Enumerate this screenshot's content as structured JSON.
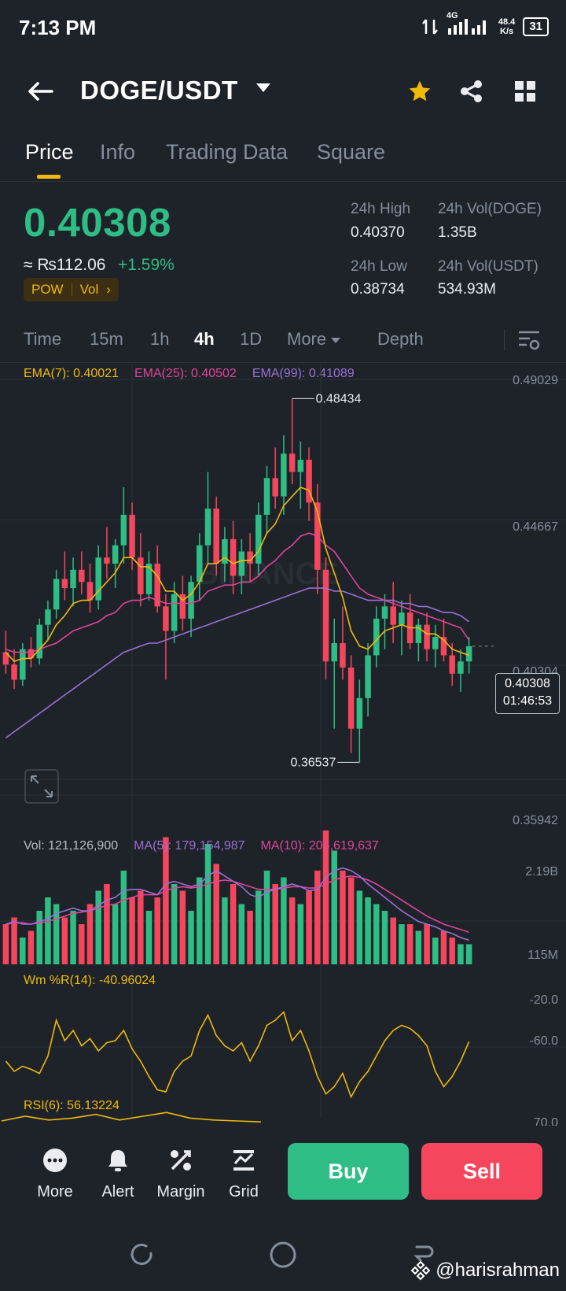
{
  "status_bar": {
    "time": "7:13 PM",
    "network": "4G",
    "speed_value": "48.4",
    "speed_unit": "K/s",
    "battery": "31"
  },
  "header": {
    "pair": "DOGE/USDT",
    "back_icon": "arrow-left-icon",
    "favorite_icon": "star-icon",
    "share_icon": "share-icon",
    "apps_icon": "grid-icon",
    "favorite_color": "#f0b90b"
  },
  "tabs": [
    "Price",
    "Info",
    "Trading Data",
    "Square"
  ],
  "active_tab": "Price",
  "price": {
    "last": "0.40308",
    "inr": "≈ ₨112.06",
    "change_pct": "+1.59%",
    "tag1": "POW",
    "tag2": "Vol",
    "tag_arrow": "›"
  },
  "stats": {
    "high_label": "24h High",
    "high_value": "0.40370",
    "low_label": "24h Low",
    "low_value": "0.38734",
    "vol_base_label": "24h Vol(DOGE)",
    "vol_base_value": "1.35B",
    "vol_quote_label": "24h Vol(USDT)",
    "vol_quote_value": "534.93M"
  },
  "intervals": [
    "Time",
    "15m",
    "1h",
    "4h",
    "1D",
    "More",
    "Depth"
  ],
  "active_interval": "4h",
  "indicators": {
    "ema7": "EMA(7): 0.40021",
    "ema25": "EMA(25): 0.40502",
    "ema99": "EMA(99): 0.41089",
    "vol": "Vol: 121,126,900",
    "ma5": "MA(5): 179,154,987",
    "ma10": "MA(10): 205,619,637",
    "wr": "Wm %R(14): -40.96024",
    "rsi": "RSI(6): 56.13224"
  },
  "price_axis": {
    "top": "0.49029",
    "mid": "0.44667",
    "low_mid": "0.40304",
    "bottom": "0.35942",
    "max_marker": "0.48434",
    "min_marker": "0.36537",
    "current": "0.40308",
    "countdown": "01:46:53"
  },
  "volume_axis": {
    "top": "2.19B",
    "bottom": "115M"
  },
  "wr_axis": {
    "upper": "-20.0",
    "lower": "-60.0"
  },
  "rsi_axis": {
    "upper": "70.0"
  },
  "watermark": "BINANCE",
  "colors": {
    "up": "#2ebd85",
    "down": "#f6465d",
    "ema7": "#f0b90b",
    "ema25": "#e0449a",
    "ema99": "#9b6fd6",
    "ma5": "#9b6fd6",
    "ma10": "#e0449a"
  },
  "chart_data": {
    "type": "candlestick",
    "interval": "4h",
    "ylim": [
      0.35942,
      0.49029
    ],
    "ohlc": [
      [
        0.401,
        0.408,
        0.394,
        0.397
      ],
      [
        0.397,
        0.402,
        0.389,
        0.392
      ],
      [
        0.392,
        0.404,
        0.39,
        0.402
      ],
      [
        0.402,
        0.406,
        0.396,
        0.399
      ],
      [
        0.399,
        0.412,
        0.397,
        0.41
      ],
      [
        0.41,
        0.418,
        0.405,
        0.415
      ],
      [
        0.415,
        0.428,
        0.412,
        0.425
      ],
      [
        0.425,
        0.434,
        0.418,
        0.422
      ],
      [
        0.422,
        0.432,
        0.416,
        0.428
      ],
      [
        0.428,
        0.434,
        0.42,
        0.424
      ],
      [
        0.424,
        0.43,
        0.414,
        0.418
      ],
      [
        0.418,
        0.436,
        0.415,
        0.432
      ],
      [
        0.432,
        0.442,
        0.425,
        0.43
      ],
      [
        0.43,
        0.438,
        0.422,
        0.436
      ],
      [
        0.436,
        0.455,
        0.43,
        0.446
      ],
      [
        0.446,
        0.45,
        0.428,
        0.432
      ],
      [
        0.432,
        0.44,
        0.416,
        0.42
      ],
      [
        0.42,
        0.434,
        0.418,
        0.43
      ],
      [
        0.43,
        0.436,
        0.414,
        0.416
      ],
      [
        0.416,
        0.42,
        0.392,
        0.408
      ],
      [
        0.408,
        0.424,
        0.404,
        0.42
      ],
      [
        0.42,
        0.426,
        0.408,
        0.412
      ],
      [
        0.412,
        0.426,
        0.406,
        0.424
      ],
      [
        0.424,
        0.44,
        0.418,
        0.436
      ],
      [
        0.436,
        0.46,
        0.43,
        0.448
      ],
      [
        0.448,
        0.452,
        0.426,
        0.43
      ],
      [
        0.43,
        0.442,
        0.424,
        0.438
      ],
      [
        0.438,
        0.444,
        0.42,
        0.426
      ],
      [
        0.426,
        0.438,
        0.42,
        0.434
      ],
      [
        0.434,
        0.44,
        0.424,
        0.43
      ],
      [
        0.43,
        0.45,
        0.426,
        0.446
      ],
      [
        0.446,
        0.462,
        0.44,
        0.458
      ],
      [
        0.458,
        0.468,
        0.448,
        0.452
      ],
      [
        0.452,
        0.472,
        0.446,
        0.466
      ],
      [
        0.466,
        0.484,
        0.456,
        0.46
      ],
      [
        0.46,
        0.47,
        0.448,
        0.464
      ],
      [
        0.464,
        0.468,
        0.444,
        0.45
      ],
      [
        0.45,
        0.456,
        0.42,
        0.428
      ],
      [
        0.428,
        0.432,
        0.392,
        0.398
      ],
      [
        0.398,
        0.412,
        0.376,
        0.404
      ],
      [
        0.404,
        0.416,
        0.392,
        0.396
      ],
      [
        0.396,
        0.4,
        0.368,
        0.376
      ],
      [
        0.376,
        0.392,
        0.365,
        0.386
      ],
      [
        0.386,
        0.404,
        0.38,
        0.4
      ],
      [
        0.4,
        0.416,
        0.396,
        0.412
      ],
      [
        0.412,
        0.42,
        0.402,
        0.416
      ],
      [
        0.416,
        0.424,
        0.404,
        0.41
      ],
      [
        0.41,
        0.418,
        0.4,
        0.414
      ],
      [
        0.414,
        0.42,
        0.402,
        0.404
      ],
      [
        0.404,
        0.412,
        0.398,
        0.41
      ],
      [
        0.41,
        0.414,
        0.398,
        0.402
      ],
      [
        0.402,
        0.41,
        0.396,
        0.406
      ],
      [
        0.406,
        0.412,
        0.398,
        0.4
      ],
      [
        0.4,
        0.404,
        0.39,
        0.394
      ],
      [
        0.394,
        0.402,
        0.388,
        0.398
      ],
      [
        0.398,
        0.406,
        0.394,
        0.403
      ]
    ],
    "ema7": [
      0.401,
      0.398,
      0.399,
      0.399,
      0.402,
      0.405,
      0.41,
      0.413,
      0.417,
      0.418,
      0.418,
      0.421,
      0.424,
      0.427,
      0.432,
      0.432,
      0.429,
      0.429,
      0.426,
      0.421,
      0.421,
      0.418,
      0.42,
      0.424,
      0.43,
      0.43,
      0.432,
      0.43,
      0.431,
      0.431,
      0.434,
      0.44,
      0.443,
      0.449,
      0.452,
      0.455,
      0.454,
      0.447,
      0.435,
      0.427,
      0.419,
      0.408,
      0.403,
      0.402,
      0.405,
      0.408,
      0.409,
      0.41,
      0.409,
      0.409,
      0.407,
      0.407,
      0.405,
      0.402,
      0.401,
      0.4
    ],
    "ema25": [
      0.402,
      0.401,
      0.401,
      0.401,
      0.402,
      0.403,
      0.404,
      0.406,
      0.408,
      0.409,
      0.41,
      0.411,
      0.413,
      0.414,
      0.417,
      0.418,
      0.418,
      0.419,
      0.418,
      0.417,
      0.417,
      0.417,
      0.417,
      0.418,
      0.421,
      0.422,
      0.423,
      0.423,
      0.424,
      0.424,
      0.426,
      0.429,
      0.431,
      0.434,
      0.436,
      0.439,
      0.44,
      0.439,
      0.436,
      0.434,
      0.43,
      0.426,
      0.422,
      0.42,
      0.419,
      0.418,
      0.417,
      0.416,
      0.415,
      0.414,
      0.413,
      0.412,
      0.411,
      0.41,
      0.409,
      0.405
    ],
    "ema99": [
      0.373,
      0.375,
      0.377,
      0.379,
      0.381,
      0.383,
      0.385,
      0.387,
      0.389,
      0.391,
      0.393,
      0.395,
      0.397,
      0.399,
      0.401,
      0.402,
      0.403,
      0.404,
      0.404,
      0.405,
      0.406,
      0.407,
      0.408,
      0.409,
      0.41,
      0.411,
      0.412,
      0.413,
      0.414,
      0.415,
      0.416,
      0.417,
      0.418,
      0.419,
      0.42,
      0.421,
      0.422,
      0.422,
      0.422,
      0.421,
      0.421,
      0.42,
      0.419,
      0.418,
      0.418,
      0.418,
      0.418,
      0.417,
      0.417,
      0.416,
      0.416,
      0.415,
      0.414,
      0.414,
      0.413,
      0.411
    ],
    "volume": [
      0.3,
      0.35,
      0.2,
      0.25,
      0.4,
      0.5,
      0.45,
      0.35,
      0.4,
      0.3,
      0.45,
      0.55,
      0.6,
      0.45,
      0.7,
      0.5,
      0.55,
      0.4,
      0.5,
      0.95,
      0.6,
      0.55,
      0.4,
      0.65,
      0.9,
      0.75,
      0.5,
      0.6,
      0.45,
      0.4,
      0.55,
      0.7,
      0.6,
      0.65,
      0.5,
      0.45,
      0.55,
      0.7,
      1.0,
      0.85,
      0.7,
      0.65,
      0.55,
      0.5,
      0.45,
      0.4,
      0.35,
      0.3,
      0.3,
      0.25,
      0.3,
      0.2,
      0.25,
      0.2,
      0.15,
      0.15
    ],
    "ma5": [
      0.3,
      0.32,
      0.3,
      0.3,
      0.32,
      0.34,
      0.38,
      0.4,
      0.42,
      0.4,
      0.4,
      0.44,
      0.48,
      0.5,
      0.55,
      0.56,
      0.56,
      0.54,
      0.52,
      0.6,
      0.62,
      0.6,
      0.58,
      0.6,
      0.66,
      0.7,
      0.66,
      0.62,
      0.58,
      0.52,
      0.5,
      0.54,
      0.56,
      0.58,
      0.6,
      0.58,
      0.55,
      0.56,
      0.65,
      0.7,
      0.72,
      0.7,
      0.66,
      0.6,
      0.55,
      0.5,
      0.45,
      0.4,
      0.36,
      0.32,
      0.3,
      0.28,
      0.25,
      0.23,
      0.2,
      0.18
    ],
    "ma10": [
      0.3,
      0.31,
      0.31,
      0.3,
      0.31,
      0.32,
      0.34,
      0.36,
      0.38,
      0.39,
      0.4,
      0.42,
      0.44,
      0.45,
      0.48,
      0.5,
      0.52,
      0.52,
      0.52,
      0.55,
      0.57,
      0.58,
      0.57,
      0.58,
      0.6,
      0.62,
      0.63,
      0.62,
      0.6,
      0.58,
      0.56,
      0.56,
      0.56,
      0.57,
      0.58,
      0.58,
      0.57,
      0.57,
      0.6,
      0.63,
      0.65,
      0.66,
      0.65,
      0.63,
      0.6,
      0.56,
      0.52,
      0.48,
      0.44,
      0.4,
      0.36,
      0.33,
      0.3,
      0.28,
      0.26,
      0.24
    ],
    "wr": [
      -60,
      -70,
      -65,
      -68,
      -72,
      -55,
      -20,
      -40,
      -30,
      -45,
      -38,
      -50,
      -42,
      -40,
      -30,
      -48,
      -60,
      -75,
      -88,
      -90,
      -70,
      -60,
      -55,
      -30,
      -15,
      -35,
      -45,
      -50,
      -42,
      -60,
      -45,
      -25,
      -20,
      -12,
      -40,
      -30,
      -50,
      -75,
      -92,
      -85,
      -72,
      -95,
      -80,
      -70,
      -55,
      -40,
      -30,
      -25,
      -28,
      -35,
      -45,
      -70,
      -85,
      -75,
      -60,
      -41
    ],
    "rsi": [
      65,
      70,
      66,
      68,
      72,
      66,
      70,
      74,
      68,
      66,
      65,
      64
    ]
  },
  "bottom_bar": {
    "more": "More",
    "alert": "Alert",
    "margin": "Margin",
    "grid": "Grid",
    "buy": "Buy",
    "sell": "Sell"
  },
  "credit": "@harisrahman"
}
